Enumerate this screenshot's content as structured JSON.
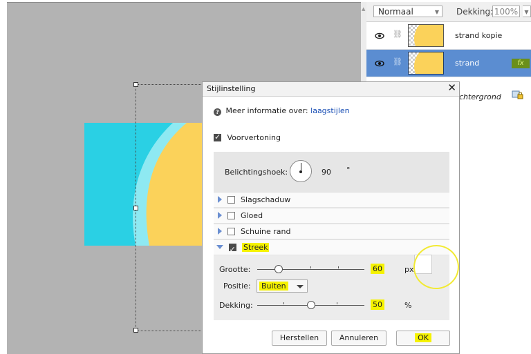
{
  "layers_panel": {
    "blend_mode": "Normaal",
    "opacity_label": "Dekking:",
    "opacity_value": "100%",
    "layers": [
      {
        "name": "strand kopie",
        "selected": false,
        "fx": ""
      },
      {
        "name": "strand",
        "selected": true,
        "fx": "fx"
      },
      {
        "name": "chtergrond",
        "selected": false,
        "fx": ""
      }
    ]
  },
  "dialog": {
    "title": "Stijlinstelling",
    "close_glyph": "✕",
    "info_prefix": "Meer informatie over:",
    "info_link": "laagstijlen",
    "preview_label": "Voorvertoning",
    "angle_label": "Belichtingshoek:",
    "angle_value": "90",
    "angle_unit": "°",
    "options": [
      {
        "label": "Slagschaduw",
        "checked": false,
        "expanded": false
      },
      {
        "label": "Gloed",
        "checked": false,
        "expanded": false
      },
      {
        "label": "Schuine rand",
        "checked": false,
        "expanded": false
      },
      {
        "label": "Streek",
        "checked": true,
        "expanded": true
      }
    ],
    "stroke": {
      "size_label": "Grootte:",
      "size_value": "60",
      "size_unit": "px",
      "size_slider_fraction": 0.2,
      "position_label": "Positie:",
      "position_value": "Buiten",
      "opacity_label": "Dekking:",
      "opacity_value": "50",
      "opacity_unit": "%",
      "opacity_slider_fraction": 0.5,
      "color": "#ffffff"
    },
    "buttons": {
      "reset": "Herstellen",
      "cancel": "Annuleren",
      "ok": "OK"
    }
  },
  "colors": {
    "canvas_bg": "#b3b3b3",
    "image_cyan": "#2ad0e4",
    "image_light_cyan": "#8ee9f2",
    "image_yellow": "#fbd25a",
    "selected_layer": "#5b8dd1",
    "highlight": "#f5f200"
  }
}
